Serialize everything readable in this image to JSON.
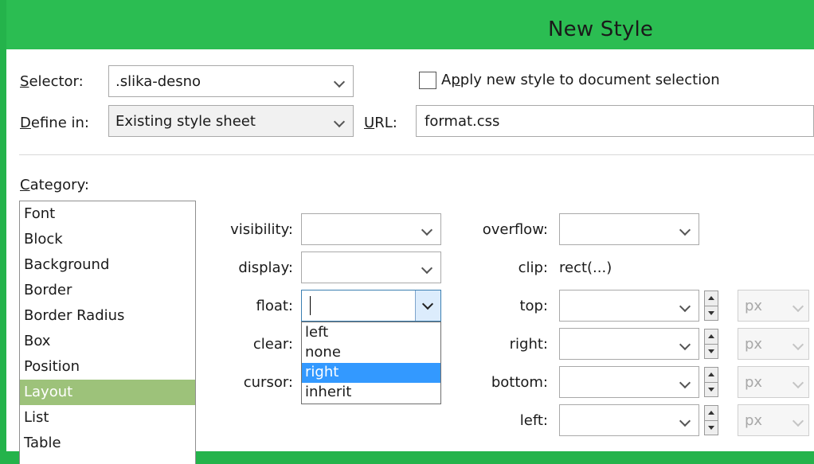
{
  "window": {
    "title": "New Style"
  },
  "selector": {
    "label_accel": "S",
    "label_rest": "elector:",
    "value": ".slika-desno"
  },
  "apply_checkbox": {
    "label_pre": "A",
    "label_accel": "p",
    "label_rest": "ply new style to document selection",
    "checked": false
  },
  "define_in": {
    "label_accel": "D",
    "label_rest": "efine in:",
    "value": "Existing style sheet"
  },
  "url": {
    "label_accel": "U",
    "label_rest": "RL:",
    "value": "format.css"
  },
  "category": {
    "label_accel": "C",
    "label_rest": "ategory:",
    "items": [
      "Font",
      "Block",
      "Background",
      "Border",
      "Border Radius",
      "Box",
      "Position",
      "Layout",
      "List",
      "Table"
    ],
    "selected": "Layout"
  },
  "layout_props": {
    "visibility": {
      "label": "visibility:",
      "value": ""
    },
    "display": {
      "label": "display:",
      "value": ""
    },
    "float": {
      "label": "float:",
      "value": "",
      "options": [
        "left",
        "none",
        "right",
        "inherit"
      ],
      "highlighted": "right"
    },
    "clear": {
      "label": "clear:"
    },
    "cursor": {
      "label": "cursor:"
    },
    "overflow": {
      "label": "overflow:",
      "value": ""
    },
    "clip": {
      "label": "clip:",
      "value": "rect(...)"
    },
    "top": {
      "label": "top:",
      "unit": "px"
    },
    "right": {
      "label": "right:",
      "unit": "px"
    },
    "bottom": {
      "label": "bottom:",
      "unit": "px"
    },
    "left": {
      "label": "left:",
      "unit": "px"
    }
  },
  "colors": {
    "titlebar": "#2bbd52",
    "selection_green": "#9dc27a",
    "highlight_blue": "#3399ff"
  }
}
